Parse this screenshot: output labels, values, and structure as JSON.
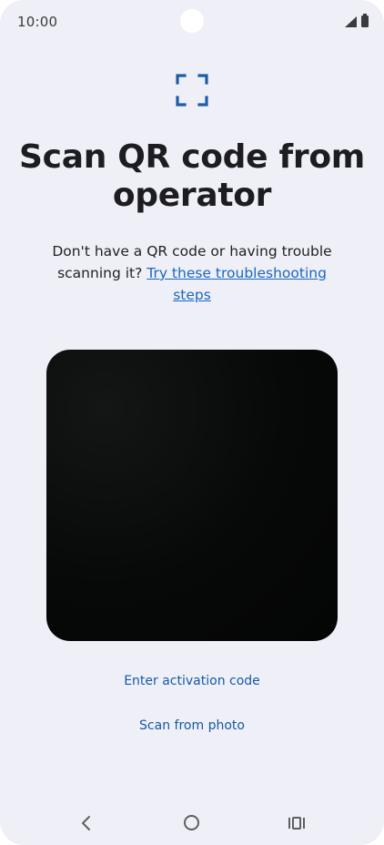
{
  "status_bar": {
    "time": "10:00",
    "icons": [
      "signal-icon",
      "battery-icon"
    ]
  },
  "header": {
    "icon": "scan-icon",
    "title": "Scan QR code from operator"
  },
  "help": {
    "prefix": "Don't have a QR code or having trouble scanning it? ",
    "link_text": "Try these troubleshooting steps"
  },
  "actions": {
    "enter_activation_code": "Enter activation code",
    "scan_from_photo": "Scan from photo"
  },
  "navigation": {
    "icons": [
      "back-icon",
      "home-icon",
      "recent-apps-icon"
    ]
  },
  "colors": {
    "background": "#eff0f7",
    "accent": "#1558a8",
    "link": "#1a66c2",
    "scan_icon": "#1d5ea6"
  }
}
